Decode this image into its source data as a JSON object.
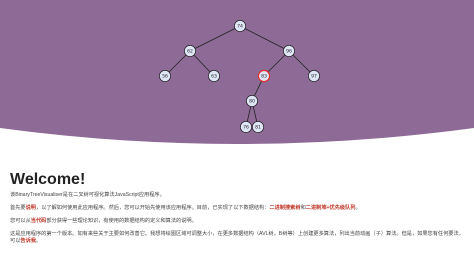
{
  "tree": {
    "nodes": [
      {
        "id": "n74",
        "label": "74",
        "highlighted": false
      },
      {
        "id": "n62",
        "label": "62",
        "highlighted": false
      },
      {
        "id": "n96",
        "label": "96",
        "highlighted": false
      },
      {
        "id": "n56",
        "label": "56",
        "highlighted": false
      },
      {
        "id": "n63",
        "label": "63",
        "highlighted": false
      },
      {
        "id": "n83",
        "label": "83",
        "highlighted": true
      },
      {
        "id": "n97",
        "label": "97",
        "highlighted": false
      },
      {
        "id": "n80",
        "label": "80",
        "highlighted": false
      },
      {
        "id": "n76",
        "label": "76",
        "highlighted": false
      },
      {
        "id": "n81",
        "label": "81",
        "highlighted": false
      }
    ],
    "edges": [
      [
        "n74",
        "n62"
      ],
      [
        "n74",
        "n96"
      ],
      [
        "n62",
        "n56"
      ],
      [
        "n62",
        "n63"
      ],
      [
        "n96",
        "n83"
      ],
      [
        "n96",
        "n97"
      ],
      [
        "n83",
        "n80"
      ],
      [
        "n80",
        "n76"
      ],
      [
        "n80",
        "n81"
      ]
    ],
    "colors": {
      "background": "#8e6a96",
      "node_fill": "#dfe6f6",
      "node_stroke": "#222222",
      "highlight_stroke": "#e03030",
      "edge": "#222222"
    }
  },
  "welcome": {
    "title": "Welcome!",
    "p1": "该BinaryTreeVisualiser是在二叉树可视化算法JavaScript应用程序。",
    "p2_a": "首先要",
    "p2_b": "说明",
    "p2_c": "，以了解如何使用此应用程序。然后，您可以开始先使用该应用程序。目前，已实现了以下数据结构：",
    "p2_d": "二进制搜索树",
    "p2_e": "和",
    "p2_f": "二进制堆+优先级队列",
    "p2_g": "。",
    "p3_a": "您可以从",
    "p3_b": "当代码",
    "p3_c": "部分获得一些理论知识，有使用的数据结构的定义和算法的说明。",
    "p4": "这是应用程序的第一个版本。如有来些关于主要如何改善它。我想将绘图区域可调整大小，在更多数据结构（AVL树，B树等）上创建更多算法，列出当前动画（子）算法。但是，如果您有任何要法，可以",
    "p4_link": "告诉我",
    "p4_end": "。"
  }
}
